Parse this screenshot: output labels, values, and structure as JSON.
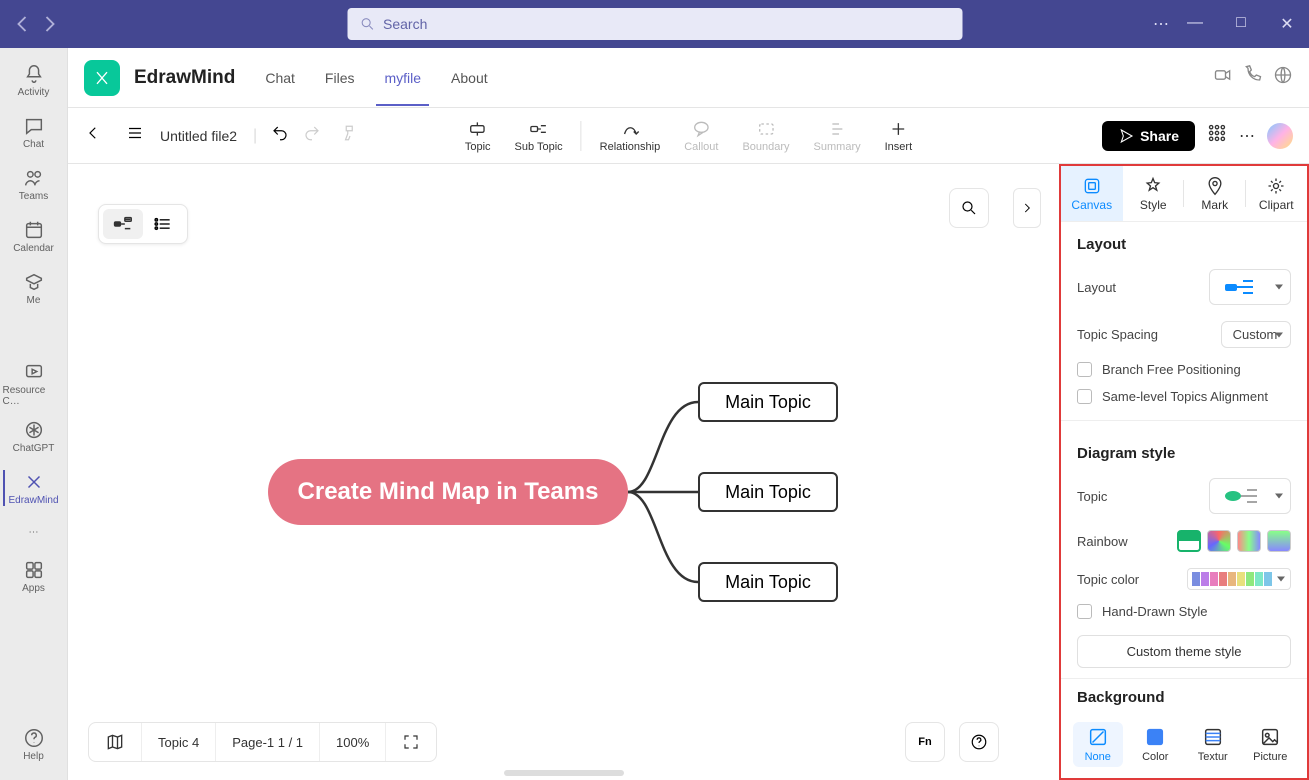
{
  "titlebar": {
    "search_placeholder": "Search"
  },
  "rail": {
    "activity": "Activity",
    "chat": "Chat",
    "teams": "Teams",
    "calendar": "Calendar",
    "me": "Me",
    "resource": "Resource C…",
    "chatgpt": "ChatGPT",
    "edrawmind": "EdrawMind",
    "apps": "Apps",
    "help": "Help"
  },
  "tabs": {
    "app_name": "EdrawMind",
    "chat": "Chat",
    "files": "Files",
    "myfile": "myfile",
    "about": "About"
  },
  "toolbar": {
    "file_name": "Untitled file2",
    "topic": "Topic",
    "subtopic": "Sub Topic",
    "relationship": "Relationship",
    "callout": "Callout",
    "boundary": "Boundary",
    "summary": "Summary",
    "insert": "Insert",
    "share": "Share"
  },
  "mindmap": {
    "central": "Create Mind Map in Teams",
    "topics": [
      "Main Topic",
      "Main Topic",
      "Main Topic"
    ]
  },
  "status": {
    "topic_count": "Topic 4",
    "page": "Page-1  1 / 1",
    "zoom": "100%"
  },
  "panel": {
    "tabs": {
      "canvas": "Canvas",
      "style": "Style",
      "mark": "Mark",
      "clipart": "Clipart"
    },
    "layout": {
      "title": "Layout",
      "layout_label": "Layout",
      "spacing_label": "Topic Spacing",
      "spacing_value": "Custom",
      "branch_free": "Branch Free Positioning",
      "same_level": "Same-level Topics Alignment"
    },
    "diagram": {
      "title": "Diagram style",
      "topic_label": "Topic",
      "rainbow_label": "Rainbow",
      "topic_color_label": "Topic color",
      "hand_drawn": "Hand-Drawn Style",
      "custom_theme": "Custom theme style",
      "palette": [
        "#7a8de0",
        "#bb7de8",
        "#e87dbd",
        "#e87d7d",
        "#e8b67d",
        "#e8e07d",
        "#8fe87d",
        "#7de8c6",
        "#7dc6e8"
      ]
    },
    "background": {
      "title": "Background",
      "none": "None",
      "color": "Color",
      "texture": "Textur",
      "picture": "Picture"
    }
  }
}
